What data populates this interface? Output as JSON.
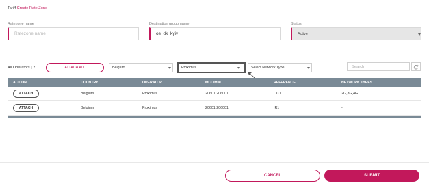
{
  "breadcrumb": {
    "parent": "Tariff",
    "current": "Create Rate Zone"
  },
  "form": {
    "ratezone": {
      "label": "Ratezone name",
      "placeholder": "Ratezone name",
      "value": ""
    },
    "destination": {
      "label": "Destination group name",
      "value": "os_dk_kyiv"
    },
    "status": {
      "label": "Status",
      "value": "Active"
    }
  },
  "operators": {
    "count_label": "All Operators",
    "separator": "|",
    "count": "2",
    "attach_all": "ATTACH ALL",
    "country_select": "Belgium",
    "operator_select": "Proximus",
    "network_select": "Select Network Type",
    "search_placeholder": "Search"
  },
  "table": {
    "headers": [
      "ACTION",
      "COUNTRY",
      "OPERATOR",
      "MCC/MNC",
      "REFERENCE",
      "NETWORK TYPES"
    ],
    "rows": [
      {
        "action": "ATTACH",
        "country": "Belgium",
        "operator": "Proximus",
        "mccmnc": "20601,206001",
        "reference": "OC1",
        "network": "2G,3G,4G"
      },
      {
        "action": "ATTACH",
        "country": "Belgium",
        "operator": "Proximus",
        "mccmnc": "20601,206001",
        "reference": "IR1",
        "network": "-"
      }
    ]
  },
  "footer": {
    "cancel": "CANCEL",
    "submit": "SUBMIT"
  },
  "colors": {
    "accent": "#c2185b",
    "table_header": "#7a8a96"
  }
}
